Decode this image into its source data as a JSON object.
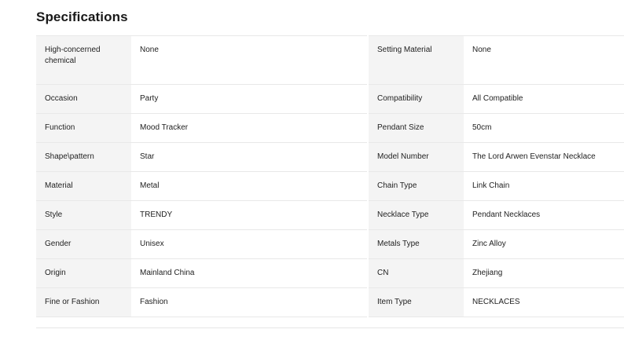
{
  "section": {
    "title": "Specifications"
  },
  "specs": [
    {
      "label_left": "High-concerned chemical",
      "value_left": "None",
      "label_right": "Setting Material",
      "value_right": "None"
    },
    {
      "label_left": "Occasion",
      "value_left": "Party",
      "label_right": "Compatibility",
      "value_right": "All Compatible"
    },
    {
      "label_left": "Function",
      "value_left": "Mood Tracker",
      "label_right": "Pendant Size",
      "value_right": "50cm"
    },
    {
      "label_left": "Shape\\pattern",
      "value_left": "Star",
      "label_right": "Model Number",
      "value_right": "The Lord Arwen Evenstar Necklace"
    },
    {
      "label_left": "Material",
      "value_left": "Metal",
      "label_right": "Chain Type",
      "value_right": "Link Chain"
    },
    {
      "label_left": "Style",
      "value_left": "TRENDY",
      "label_right": "Necklace Type",
      "value_right": "Pendant Necklaces"
    },
    {
      "label_left": "Gender",
      "value_left": "Unisex",
      "label_right": "Metals Type",
      "value_right": "Zinc Alloy"
    },
    {
      "label_left": "Origin",
      "value_left": "Mainland China",
      "label_right": "CN",
      "value_right": "Zhejiang"
    },
    {
      "label_left": "Fine or Fashion",
      "value_left": "Fashion",
      "label_right": "Item Type",
      "value_right": "NECKLACES"
    }
  ]
}
